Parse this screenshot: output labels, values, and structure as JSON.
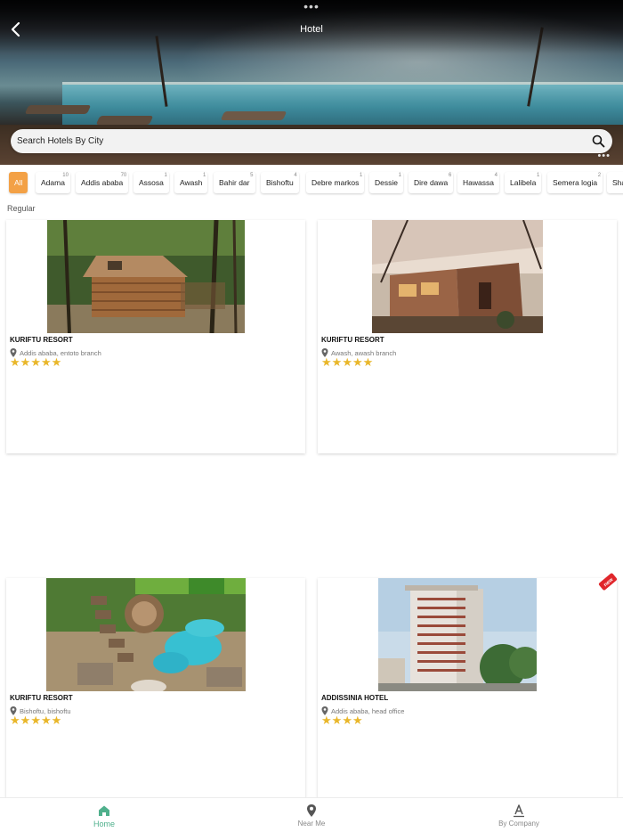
{
  "header": {
    "title": "Hotel",
    "search_placeholder": "Search Hotels By City"
  },
  "cities": [
    {
      "label": "All",
      "count": "",
      "active": true
    },
    {
      "label": "Adama",
      "count": "10"
    },
    {
      "label": "Addis ababa",
      "count": "70"
    },
    {
      "label": "Assosa",
      "count": "1"
    },
    {
      "label": "Awash",
      "count": "1"
    },
    {
      "label": "Bahir dar",
      "count": "5"
    },
    {
      "label": "Bishoftu",
      "count": "4"
    },
    {
      "label": "Debre markos",
      "count": "1"
    },
    {
      "label": "Dessie",
      "count": "1"
    },
    {
      "label": "Dire dawa",
      "count": "6"
    },
    {
      "label": "Hawassa",
      "count": "4"
    },
    {
      "label": "Lalibela",
      "count": "1"
    },
    {
      "label": "Semera logia",
      "count": "2"
    },
    {
      "label": "Sha",
      "count": ""
    }
  ],
  "section_label": "Regular",
  "hotels": [
    {
      "name": "KURIFTU RESORT",
      "location": "Addis ababa, entoto branch",
      "stars": 5
    },
    {
      "name": "KURIFTU RESORT",
      "location": "Awash, awash branch",
      "stars": 5
    },
    {
      "name": "KURIFTU RESORT",
      "location": "Bishoftu, bishoftu",
      "stars": 5
    },
    {
      "name": "ADDISSINIA HOTEL",
      "location": "Addis ababa, head office",
      "stars": 4,
      "badge": "new"
    }
  ],
  "nav": [
    {
      "label": "Home",
      "icon": "home-icon",
      "active": true
    },
    {
      "label": "Near Me",
      "icon": "location-pin-icon"
    },
    {
      "label": "By Company",
      "icon": "company-icon"
    }
  ],
  "colors": {
    "accent_orange": "#f3a146",
    "star_gold": "#e9b72b",
    "nav_active_green": "#4fb08c"
  }
}
